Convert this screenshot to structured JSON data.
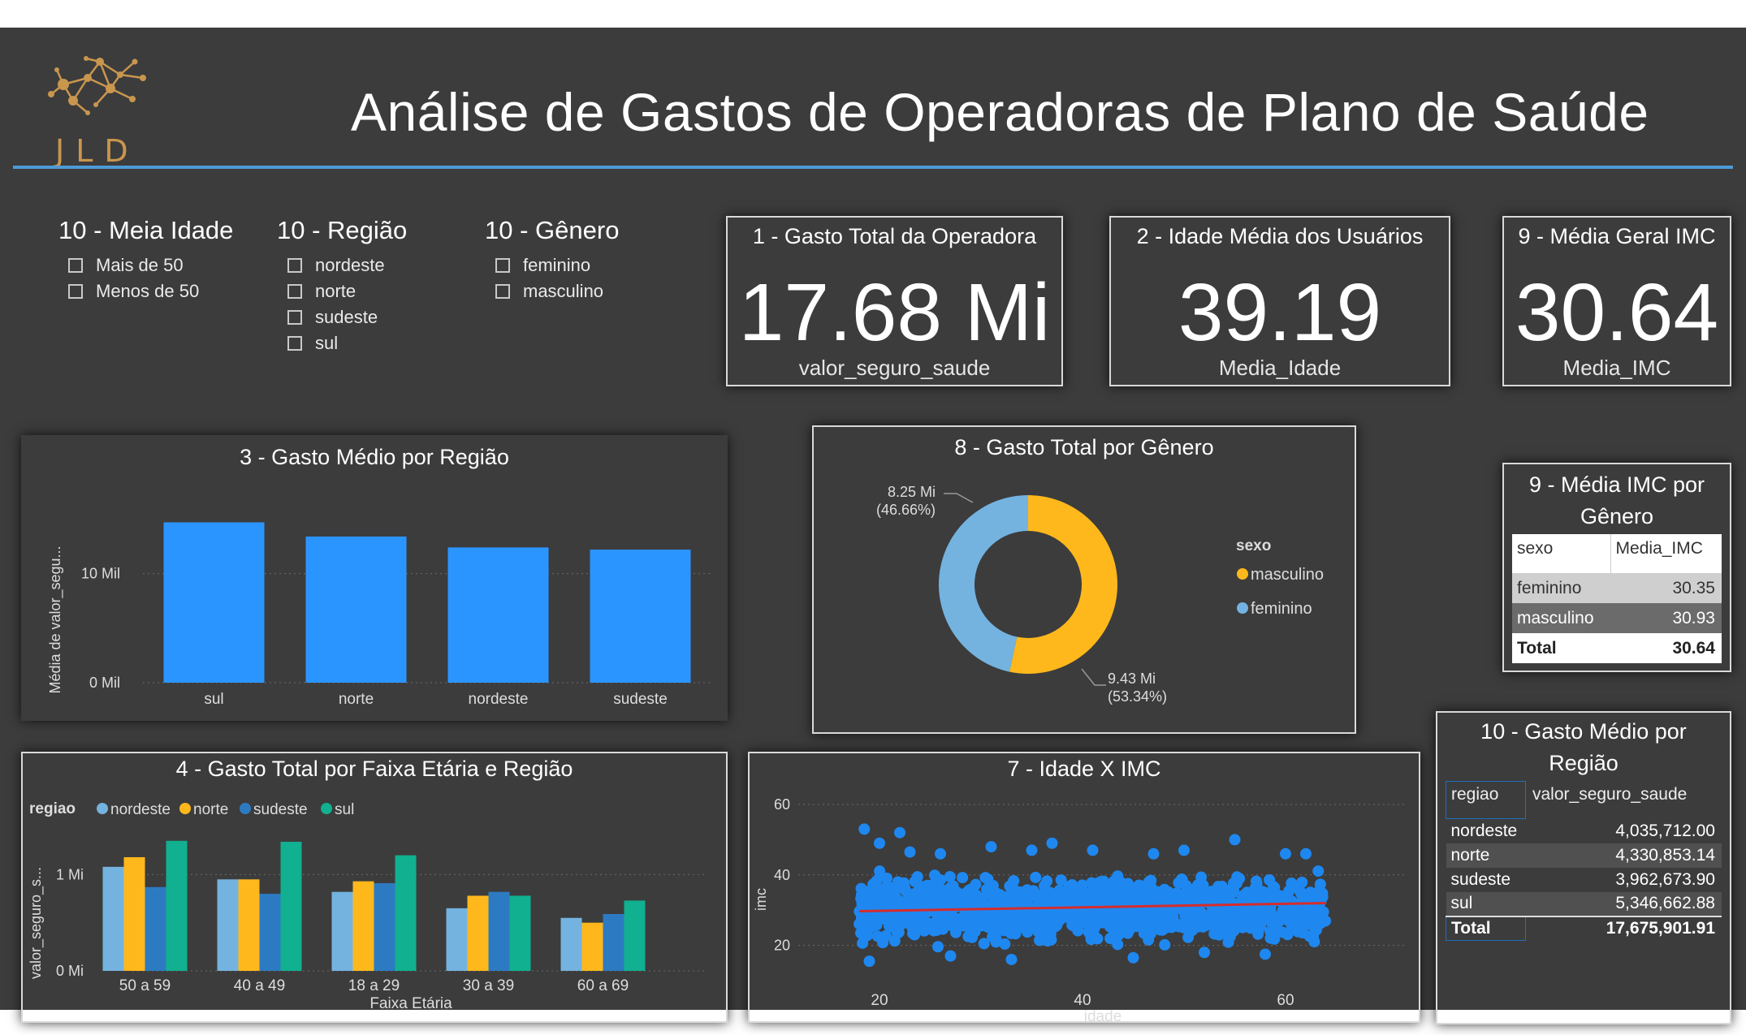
{
  "header": {
    "title": "Análise  de Gastos de Operadoras de Plano de Saúde",
    "logo_text": "JLD"
  },
  "colors": {
    "background": "#3c3c3c",
    "accent_line": "#4e9ad6",
    "bar_blue": "#2b95ff",
    "nordeste": "#74b3e0",
    "norte": "#ffb81c",
    "sudeste": "#2c7bc2",
    "sul": "#10b090",
    "trend": "#d62c2c"
  },
  "slicers": [
    {
      "title": "10 - Meia Idade",
      "items": [
        "Mais de 50",
        "Menos de 50"
      ]
    },
    {
      "title": "10 - Região",
      "items": [
        "nordeste",
        "norte",
        "sudeste",
        "sul"
      ]
    },
    {
      "title": "10 - Gênero",
      "items": [
        "feminino",
        "masculino"
      ]
    }
  ],
  "kpis": [
    {
      "title": "1 - Gasto Total da Operadora",
      "value": "17.68 Mi",
      "label": "valor_seguro_saude"
    },
    {
      "title": "2 - Idade Média dos Usuários",
      "value": "39.19",
      "label": "Media_Idade"
    },
    {
      "title": "9 - Média Geral IMC",
      "value": "30.64",
      "label": "Media_IMC"
    }
  ],
  "chart_data": [
    {
      "id": "gasto_medio_regiao",
      "type": "bar",
      "title": "3 - Gasto Médio por Região",
      "ylabel": "Média de valor_segu...",
      "categories": [
        "sul",
        "norte",
        "nordeste",
        "sudeste"
      ],
      "values": [
        14700,
        13400,
        12400,
        12200
      ],
      "yticks": [
        {
          "value": 0,
          "label": "0 Mil"
        },
        {
          "value": 10000,
          "label": "10 Mil"
        }
      ],
      "ylim": [
        0,
        16000
      ]
    },
    {
      "id": "gasto_total_genero",
      "type": "pie",
      "title": "8 - Gasto Total por Gênero",
      "legend_title": "sexo",
      "slices": [
        {
          "name": "masculino",
          "value": 9.43,
          "label": "9.43 Mi",
          "pct": "(53.34%)"
        },
        {
          "name": "feminino",
          "value": 8.25,
          "label": "8.25 Mi",
          "pct": "(46.66%)"
        }
      ]
    },
    {
      "id": "gasto_faixa_regiao",
      "type": "bar",
      "title": "4 - Gasto Total por Faixa Etária e Região",
      "xlabel": "Faixa Etária",
      "ylabel": "valor_seguro_s...",
      "legend_title": "regiao",
      "categories": [
        "50 a 59",
        "40 a 49",
        "18 a 29",
        "30 a 39",
        "60 a 69"
      ],
      "series": [
        {
          "name": "nordeste",
          "values": [
            1.08,
            0.95,
            0.82,
            0.65,
            0.55
          ]
        },
        {
          "name": "norte",
          "values": [
            1.18,
            0.95,
            0.93,
            0.78,
            0.5
          ]
        },
        {
          "name": "sudeste",
          "values": [
            0.87,
            0.8,
            0.91,
            0.82,
            0.59
          ]
        },
        {
          "name": "sul",
          "values": [
            1.35,
            1.34,
            1.2,
            0.78,
            0.73
          ]
        }
      ],
      "yticks": [
        {
          "value": 0,
          "label": "0 Mi"
        },
        {
          "value": 1,
          "label": "1 Mi"
        }
      ],
      "ylim": [
        0,
        1.5
      ]
    },
    {
      "id": "idade_x_imc",
      "type": "scatter",
      "title": "7 - Idade X IMC",
      "xlabel": "idade",
      "ylabel": "imc",
      "xticks": [
        20,
        40,
        60
      ],
      "yticks": [
        20,
        40,
        60
      ],
      "xlim": [
        12,
        72
      ],
      "ylim": [
        10,
        63
      ],
      "x_range": [
        18,
        64
      ],
      "y_range": [
        16,
        53
      ],
      "trend": {
        "x": [
          18,
          64
        ],
        "y": [
          29.7,
          32.0
        ]
      },
      "outliers": [
        [
          18.5,
          53
        ],
        [
          20,
          49
        ],
        [
          22,
          52
        ],
        [
          23,
          46.5
        ],
        [
          26,
          46
        ],
        [
          31,
          48
        ],
        [
          35,
          47
        ],
        [
          37,
          49
        ],
        [
          41,
          47
        ],
        [
          47,
          46
        ],
        [
          50,
          47
        ],
        [
          55,
          50
        ],
        [
          60,
          46
        ],
        [
          62,
          46
        ],
        [
          27,
          17
        ],
        [
          33,
          16
        ],
        [
          19,
          15.5
        ],
        [
          45,
          16.5
        ],
        [
          52,
          18
        ],
        [
          58,
          17.5
        ]
      ]
    }
  ],
  "imc_genero": {
    "title": "9 - Média IMC por Gênero",
    "headers": [
      "sexo",
      "Media_IMC"
    ],
    "rows": [
      [
        "feminino",
        "30.35"
      ],
      [
        "masculino",
        "30.93"
      ]
    ],
    "total": [
      "Total",
      "30.64"
    ]
  },
  "gasto_medio_regiao_tabela": {
    "title": "10 - Gasto Médio por Região",
    "headers": [
      "regiao",
      "valor_seguro_saude"
    ],
    "rows": [
      [
        "nordeste",
        "4,035,712.00"
      ],
      [
        "norte",
        "4,330,853.14"
      ],
      [
        "sudeste",
        "3,962,673.90"
      ],
      [
        "sul",
        "5,346,662.88"
      ]
    ],
    "total": [
      "Total",
      "17,675,901.91"
    ]
  }
}
